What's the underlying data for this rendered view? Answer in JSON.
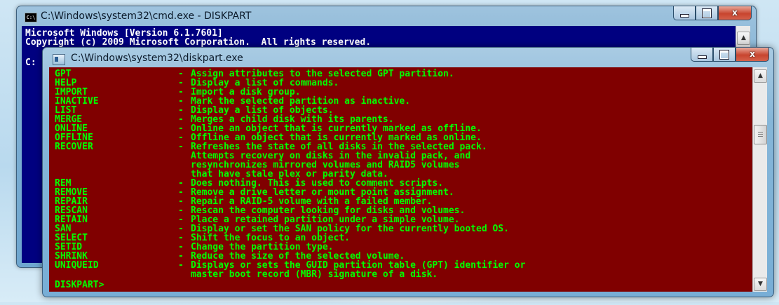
{
  "back_window": {
    "title": "C:\\Windows\\system32\\cmd.exe - DISKPART",
    "icon_label": "C:\\",
    "console_lines": [
      "Microsoft Windows [Version 6.1.7601]",
      "Copyright (c) 2009 Microsoft Corporation.  All rights reserved.",
      "C:"
    ],
    "minimize_glyph": "",
    "maximize_glyph": "",
    "close_glyph": "x"
  },
  "front_window": {
    "title": "C:\\Windows\\system32\\diskpart.exe",
    "close_glyph": "x",
    "commands": [
      {
        "name": "GPT",
        "dash": "-",
        "desc": "Assign attributes to the selected GPT partition."
      },
      {
        "name": "HELP",
        "dash": "-",
        "desc": "Display a list of commands."
      },
      {
        "name": "IMPORT",
        "dash": "-",
        "desc": "Import a disk group."
      },
      {
        "name": "INACTIVE",
        "dash": "-",
        "desc": "Mark the selected partition as inactive."
      },
      {
        "name": "LIST",
        "dash": "-",
        "desc": "Display a list of objects."
      },
      {
        "name": "MERGE",
        "dash": "-",
        "desc": "Merges a child disk with its parents."
      },
      {
        "name": "ONLINE",
        "dash": "-",
        "desc": "Online an object that is currently marked as offline."
      },
      {
        "name": "OFFLINE",
        "dash": "-",
        "desc": "Offline an object that is currently marked as online."
      },
      {
        "name": "RECOVER",
        "dash": "-",
        "desc": "Refreshes the state of all disks in the selected pack."
      },
      {
        "name": "",
        "dash": "",
        "desc": "Attempts recovery on disks in the invalid pack, and"
      },
      {
        "name": "",
        "dash": "",
        "desc": "resynchronizes mirrored volumes and RAID5 volumes"
      },
      {
        "name": "",
        "dash": "",
        "desc": "that have stale plex or parity data."
      },
      {
        "name": "REM",
        "dash": "-",
        "desc": "Does nothing. This is used to comment scripts."
      },
      {
        "name": "REMOVE",
        "dash": "-",
        "desc": "Remove a drive letter or mount point assignment."
      },
      {
        "name": "REPAIR",
        "dash": "-",
        "desc": "Repair a RAID-5 volume with a failed member."
      },
      {
        "name": "RESCAN",
        "dash": "-",
        "desc": "Rescan the computer looking for disks and volumes."
      },
      {
        "name": "RETAIN",
        "dash": "-",
        "desc": "Place a retained partition under a simple volume."
      },
      {
        "name": "SAN",
        "dash": "-",
        "desc": "Display or set the SAN policy for the currently booted OS."
      },
      {
        "name": "SELECT",
        "dash": "-",
        "desc": "Shift the focus to an object."
      },
      {
        "name": "SETID",
        "dash": "-",
        "desc": "Change the partition type."
      },
      {
        "name": "SHRINK",
        "dash": "-",
        "desc": "Reduce the size of the selected volume."
      },
      {
        "name": "UNIQUEID",
        "dash": "-",
        "desc": "Displays or sets the GUID partition table (GPT) identifier or"
      },
      {
        "name": "",
        "dash": "",
        "desc": "master boot record (MBR) signature of a disk."
      }
    ],
    "prompt": "DISKPART>"
  },
  "scroll": {
    "up_glyph": "▲",
    "down_glyph": "▼"
  },
  "colors": {
    "front_console_bg": "#800000",
    "front_console_text": "#00FF00",
    "back_console_bg": "#000080",
    "back_console_text": "#FFFFFF"
  }
}
